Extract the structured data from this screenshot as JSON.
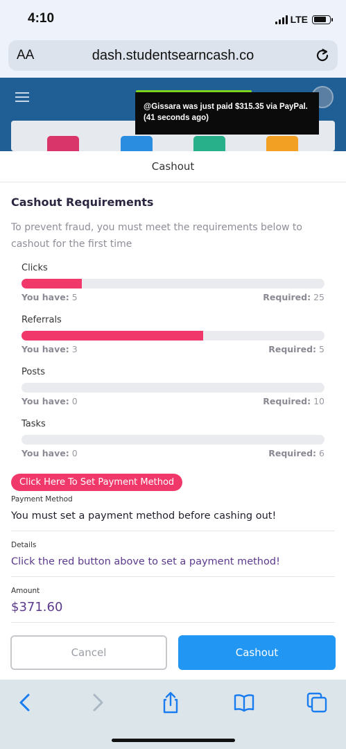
{
  "status_bar": {
    "time": "4:10",
    "network": "LTE"
  },
  "browser": {
    "aa": "AA",
    "url": "dash.studentsearncash.co"
  },
  "notification": {
    "text": "@Gissara was just paid $315.35 via PayPal. (41 seconds ago)"
  },
  "modal": {
    "title": "Cashout",
    "section_title": "Cashout Requirements",
    "intro": "To prevent fraud, you must meet the requirements below to cashout for the first time",
    "have_label": "You have:",
    "required_label": "Required:",
    "requirements": [
      {
        "label": "Clicks",
        "have": "5",
        "required": "25",
        "progress": 0.2
      },
      {
        "label": "Referrals",
        "have": "3",
        "required": "5",
        "progress": 0.6
      },
      {
        "label": "Posts",
        "have": "0",
        "required": "10",
        "progress": 0
      },
      {
        "label": "Tasks",
        "have": "0",
        "required": "6",
        "progress": 0
      }
    ],
    "payment_button": "Click Here To Set Payment Method",
    "payment_method": {
      "label": "Payment Method",
      "value": "You must set a payment method before cashing out!"
    },
    "details": {
      "label": "Details",
      "value": "Click the red button above to set a payment method!"
    },
    "amount": {
      "label": "Amount",
      "value": "$371.60"
    },
    "cancel": "Cancel",
    "cashout": "Cashout"
  },
  "colors": {
    "accent": "#f0396a",
    "primary": "#2196f3",
    "value_purple": "#5b3a8c",
    "header_blue": "#1f5f95"
  },
  "icons": [
    "signal-icon",
    "battery-icon",
    "reload-icon",
    "hamburger-icon",
    "back-icon",
    "forward-icon",
    "share-icon",
    "bookmarks-icon",
    "tabs-icon"
  ]
}
